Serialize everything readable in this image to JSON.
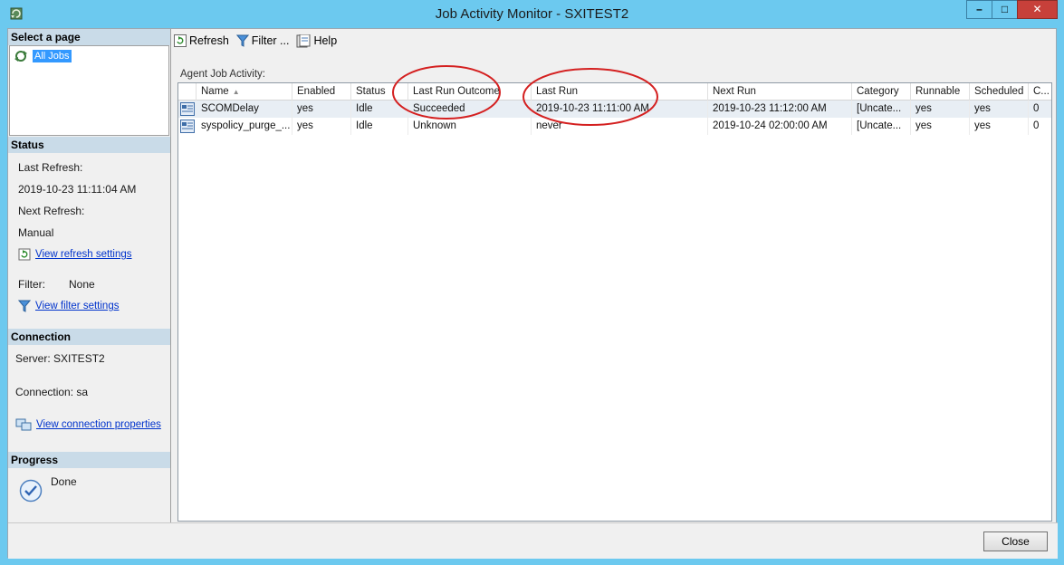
{
  "window": {
    "title": "Job Activity Monitor - SXITEST2",
    "minimize": "–",
    "maximize": "□",
    "close": "✕"
  },
  "left": {
    "select_page": "Select a page",
    "pages": [
      {
        "label": "All Jobs"
      }
    ],
    "status": {
      "heading": "Status",
      "last_refresh_label": "Last Refresh:",
      "last_refresh_value": "2019-10-23 11:11:04 AM",
      "next_refresh_label": "Next Refresh:",
      "next_refresh_value": "Manual",
      "refresh_link": "View refresh settings",
      "filter_label": "Filter:",
      "filter_value": "None",
      "filter_link": "View filter settings"
    },
    "connection": {
      "heading": "Connection",
      "server": "Server: SXITEST2",
      "connection": "Connection: sa",
      "properties_link": "View connection properties"
    },
    "progress": {
      "heading": "Progress",
      "status": "Done"
    }
  },
  "toolbar": {
    "refresh": "Refresh",
    "filter": "Filter ...",
    "help": "Help"
  },
  "grid": {
    "label": "Agent Job Activity:",
    "columns": [
      "Name",
      "Enabled",
      "Status",
      "Last Run Outcome",
      "Last Run",
      "Next Run",
      "Category",
      "Runnable",
      "Scheduled",
      "C..."
    ],
    "sorted_indicator": "▲",
    "rows": [
      {
        "name": "SCOMDelay",
        "enabled": "yes",
        "status": "Idle",
        "outcome": "Succeeded",
        "last_run": "2019-10-23 11:11:00 AM",
        "next_run": "2019-10-23 11:12:00 AM",
        "category": "[Uncate...",
        "runnable": "yes",
        "scheduled": "yes",
        "c": "0"
      },
      {
        "name": "syspolicy_purge_...",
        "enabled": "yes",
        "status": "Idle",
        "outcome": "Unknown",
        "last_run": "never",
        "next_run": "2019-10-24 02:00:00 AM",
        "category": "[Uncate...",
        "runnable": "yes",
        "scheduled": "yes",
        "c": "0"
      }
    ]
  },
  "buttons": {
    "close": "Close"
  },
  "colors": {
    "titlebar": "#6cc9ef",
    "section_header": "#c9dbe8",
    "annotation": "#d42020",
    "link": "#0033cc"
  }
}
